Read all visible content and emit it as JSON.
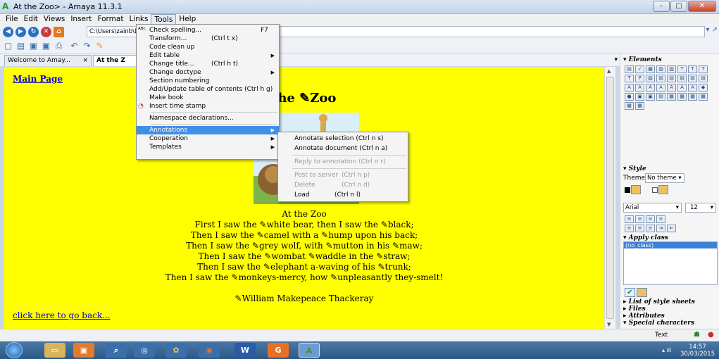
{
  "window": {
    "title": "At the Zoo> - Amaya 11.3.1"
  },
  "menubar": [
    "File",
    "Edit",
    "Views",
    "Insert",
    "Format",
    "Links",
    "Tools",
    "Help"
  ],
  "address": {
    "value": "C:\\Users\\zainb\\De"
  },
  "tabs": [
    {
      "label": "Welcome to Amay...",
      "close": "×"
    },
    {
      "label": "At the Z"
    }
  ],
  "document": {
    "main_link": "Main Page",
    "heading": "the ✎Zoo",
    "poem_title": "At the Zoo",
    "lines": [
      "First I saw the ✎white bear, then I saw the ✎black;",
      "Then I saw the ✎camel with a ✎hump upon his back;",
      "Then I saw the ✎grey wolf, with ✎mutton in his ✎maw;",
      "Then I saw the ✎wombat ✎waddle in the ✎straw;",
      "Then I saw the ✎elephant a-waving of his ✎trunk;",
      "Then I saw the ✎monkeys-mercy, how ✎unpleasantly they-smelt!"
    ],
    "author": "✎William Makepeace Thackeray",
    "back_link": "click here to go back..."
  },
  "tools_menu": [
    {
      "label": "Check spelling...",
      "shortcut": "F7",
      "icon": "spellcheck-icon"
    },
    {
      "label": "Transform...",
      "shortcut": "(Ctrl t x)"
    },
    {
      "label": "Code clean up"
    },
    {
      "label": "Edit table",
      "submenu": true
    },
    {
      "label": "Change title...",
      "shortcut": "(Ctrl h t)"
    },
    {
      "label": "Change doctype",
      "submenu": true
    },
    {
      "label": "Section numbering"
    },
    {
      "label": "Add/Update table of contents (Ctrl h g)"
    },
    {
      "label": "Make book"
    },
    {
      "label": "Insert time stamp",
      "icon": "clock-icon"
    },
    {
      "sep": true
    },
    {
      "label": "Namespace declarations..."
    },
    {
      "sep": true
    },
    {
      "label": "Annotations",
      "submenu": true,
      "highlighted": true
    },
    {
      "label": "Cooperation",
      "submenu": true
    },
    {
      "label": "Templates",
      "submenu": true
    }
  ],
  "annotations_menu": [
    {
      "label": "Annotate selection (Ctrl n s)"
    },
    {
      "label": "Annotate document  (Ctrl n a)"
    },
    {
      "sep": true
    },
    {
      "label": "Reply to annotation (Ctrl n r)",
      "disabled": true
    },
    {
      "sep": true
    },
    {
      "label": "Post to server",
      "shortcut": "(Ctrl n p)",
      "disabled": true
    },
    {
      "label": "Delete",
      "shortcut": "(Ctrl n d)",
      "disabled": true
    },
    {
      "label": "Load",
      "shortcut": "(Ctrl n l)"
    }
  ],
  "right_panel": {
    "elements_title": "Elements",
    "style_title": "Style",
    "theme_label": "Theme",
    "theme_value": "No theme",
    "font": "Arial",
    "font_size": "12",
    "apply_class_title": "Apply class",
    "class_item": "(no_class)",
    "stylesheets": "List of style sheets",
    "files": "Files",
    "attributes": "Attributes",
    "special_chars": "Special characters"
  },
  "status": {
    "mode": "Text"
  },
  "clock": {
    "time": "14:57",
    "date": "30/03/2015"
  }
}
